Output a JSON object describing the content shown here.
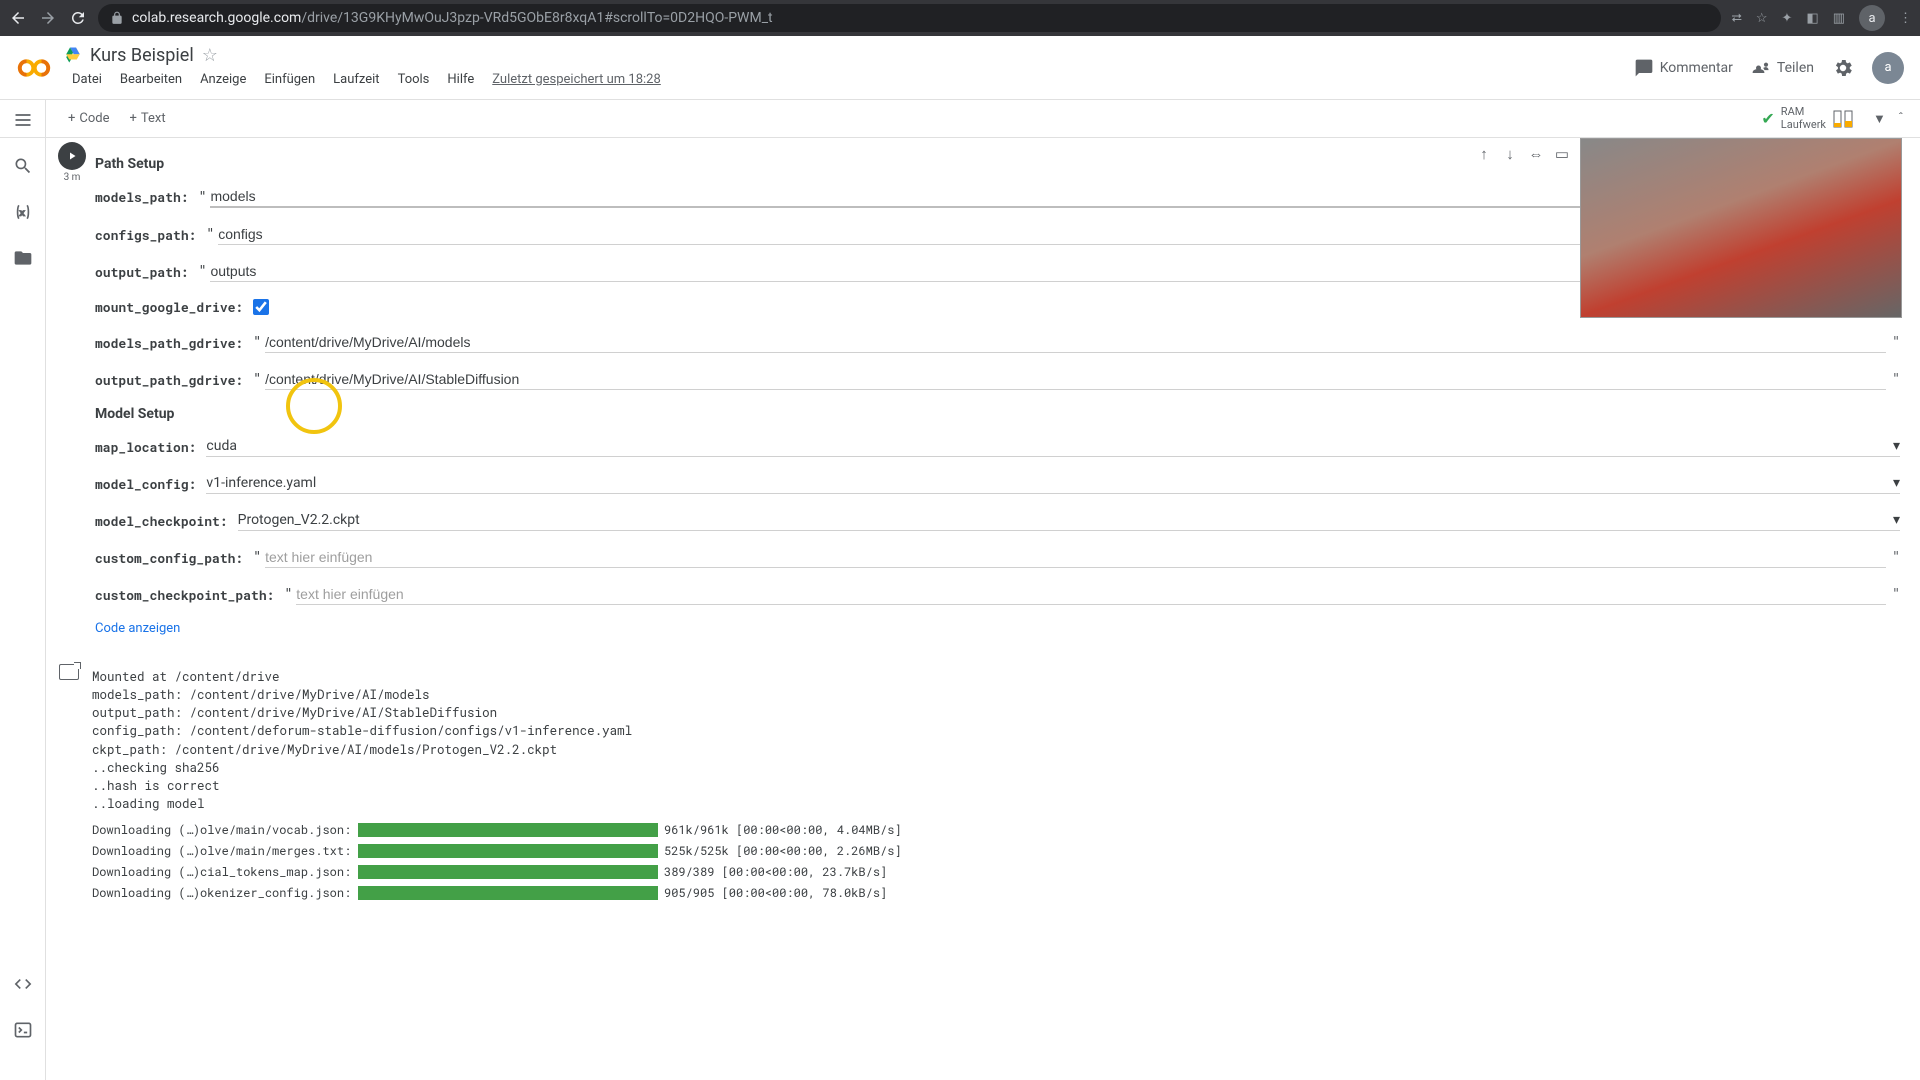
{
  "browser": {
    "url_domain": "colab.research.google.com",
    "url_path": "/drive/13G9KHyMwOuJ3pzp-VRd5GObE8r8xqA1#scrollTo=0D2HQO-PWM_t"
  },
  "header": {
    "title": "Kurs Beispiel",
    "menu": [
      "Datei",
      "Bearbeiten",
      "Anzeige",
      "Einfügen",
      "Laufzeit",
      "Tools",
      "Hilfe"
    ],
    "saved": "Zuletzt gespeichert um 18:28",
    "kommentar": "Kommentar",
    "teilen": "Teilen",
    "avatar_letter": "a"
  },
  "toolbar": {
    "code": "Code",
    "text": "Text",
    "status_top": "RAM",
    "status_bottom": "Laufwerk"
  },
  "cell": {
    "exec_label": "3 m",
    "path_setup_title": "Path Setup",
    "model_setup_title": "Model Setup",
    "labels": {
      "models_path": "models_path:",
      "configs_path": "configs_path:",
      "output_path": "output_path:",
      "mount_google_drive": "mount_google_drive:",
      "models_path_gdrive": "models_path_gdrive:",
      "output_path_gdrive": "output_path_gdrive:",
      "map_location": "map_location:",
      "model_config": "model_config:",
      "model_checkpoint": "model_checkpoint:",
      "custom_config_path": "custom_config_path:",
      "custom_checkpoint_path": "custom_checkpoint_path:"
    },
    "values": {
      "models_path": "models",
      "configs_path": "configs",
      "output_path": "outputs",
      "models_path_gdrive": "/content/drive/MyDrive/AI/models",
      "output_path_gdrive": "/content/drive/MyDrive/AI/StableDiffusion",
      "map_location": "cuda",
      "model_config": "v1-inference.yaml",
      "model_checkpoint": "Protogen_V2.2.ckpt"
    },
    "placeholders": {
      "text_hier": "text hier einfügen"
    },
    "code_link": "Code anzeigen"
  },
  "output": {
    "lines": "Mounted at /content/drive\nmodels_path: /content/drive/MyDrive/AI/models\noutput_path: /content/drive/MyDrive/AI/StableDiffusion\nconfig_path: /content/deforum-stable-diffusion/configs/v1-inference.yaml\nckpt_path: /content/drive/MyDrive/AI/models/Protogen_V2.2.ckpt\n..checking sha256\n..hash is correct\n..loading model",
    "downloads": [
      {
        "label": "Downloading (…)olve/main/vocab.json: 100%",
        "stats": "961k/961k [00:00<00:00, 4.04MB/s]"
      },
      {
        "label": "Downloading (…)olve/main/merges.txt: 100%",
        "stats": "525k/525k [00:00<00:00, 2.26MB/s]"
      },
      {
        "label": "Downloading (…)cial_tokens_map.json: 100%",
        "stats": "389/389 [00:00<00:00, 23.7kB/s]"
      },
      {
        "label": "Downloading (…)okenizer_config.json: 100%",
        "stats": "905/905 [00:00<00:00, 78.0kB/s]"
      }
    ]
  }
}
